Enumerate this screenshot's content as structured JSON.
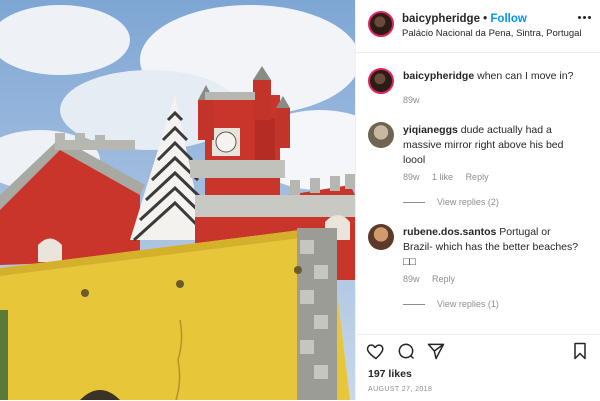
{
  "header": {
    "username": "baicypheridge",
    "separator": "•",
    "follow_label": "Follow",
    "location": "Palácio Nacional da Pena, Sintra, Portugal",
    "more_icon": "more-icon"
  },
  "caption": {
    "username": "baicypheridge",
    "text": "when can I move in?",
    "age": "89w"
  },
  "comments": [
    {
      "username": "yiqianeggs",
      "text": "dude actually had a massive mirror right above his bed loool",
      "age": "89w",
      "likes": "1 like",
      "reply": "Reply",
      "view_replies": "View replies (2)"
    },
    {
      "username": "rubene.dos.santos",
      "text": "Portugal or Brazil- which has the better beaches? □□",
      "age": "89w",
      "reply": "Reply",
      "view_replies": "View replies (1)"
    }
  ],
  "actions": {
    "icons": [
      "heart-icon",
      "comment-icon",
      "share-icon",
      "bookmark-icon"
    ],
    "likes_count": "197 likes",
    "date": "AUGUST 27, 2018"
  },
  "colors": {
    "follow": "#0095f6",
    "text": "#262626",
    "muted": "#8e8e8e",
    "wall_yellow": "#e8c63a",
    "wall_red": "#c9352b"
  }
}
